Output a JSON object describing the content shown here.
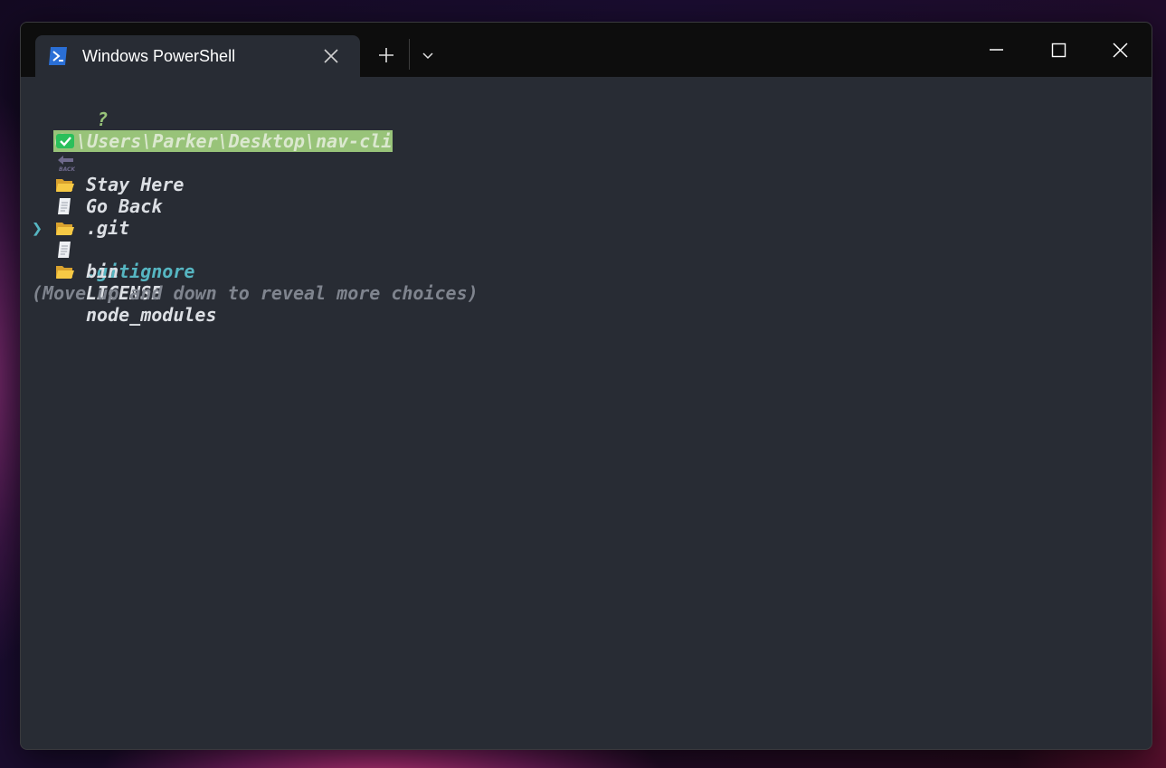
{
  "window": {
    "tab_title": "Windows PowerShell"
  },
  "terminal": {
    "prompt_symbol": "?",
    "cwd": "C:\\Users\\Parker\\Desktop\\nav-cli",
    "pointer": "❯",
    "choices": [
      {
        "label": "Stay Here",
        "icon": "check-icon",
        "selected": false
      },
      {
        "label": "Go Back",
        "icon": "back-arrow-icon",
        "selected": false
      },
      {
        "label": ".git",
        "icon": "folder-icon",
        "selected": false
      },
      {
        "label": ".gitignore",
        "icon": "file-icon",
        "selected": true
      },
      {
        "label": "bin",
        "icon": "folder-icon",
        "selected": false
      },
      {
        "label": "LICENSE",
        "icon": "file-icon",
        "selected": false
      },
      {
        "label": "node_modules",
        "icon": "folder-icon",
        "selected": false
      }
    ],
    "hint": "(Move up and down to reveal more choices)"
  },
  "colors": {
    "terminal_bg": "#282c34",
    "titlebar_bg": "#0d0d0d",
    "prompt_green": "#98c379",
    "selection_cyan": "#56b6c2",
    "hint_gray": "#7f848e"
  }
}
